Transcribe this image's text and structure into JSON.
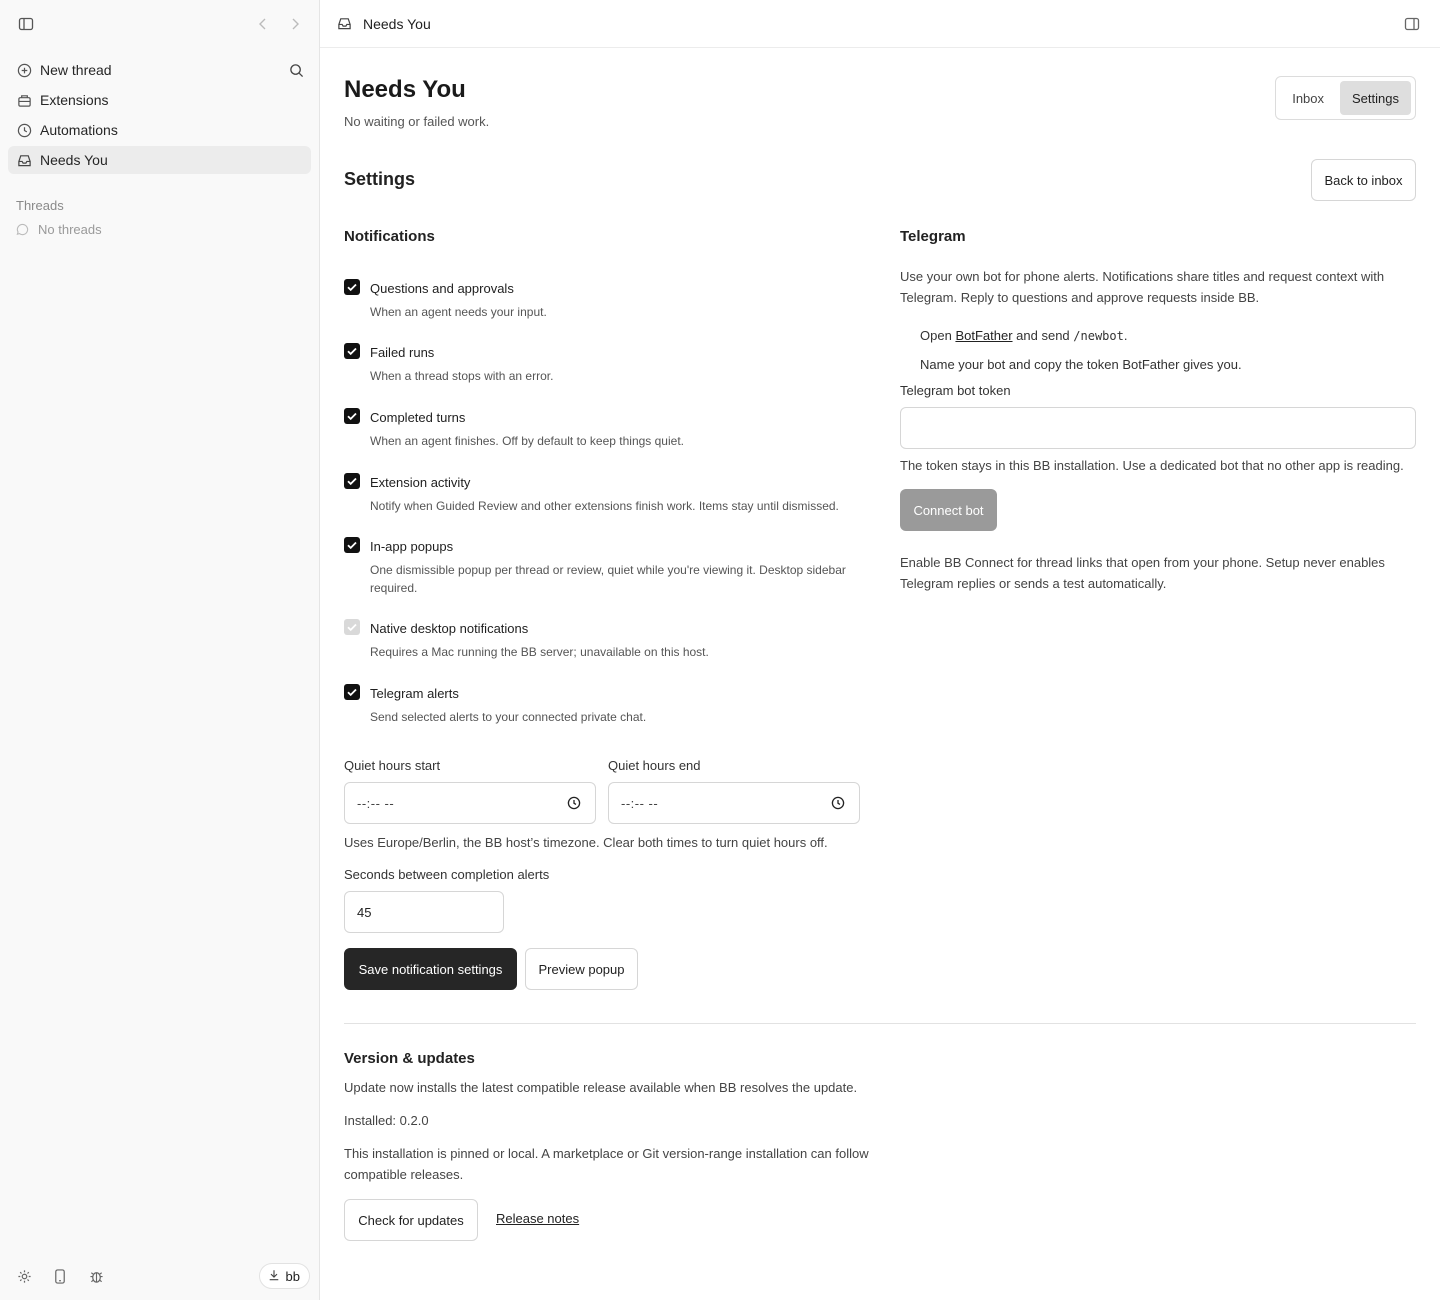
{
  "sidebar": {
    "items": [
      {
        "label": "New thread",
        "icon": "plus-circle-icon"
      },
      {
        "label": "Extensions",
        "icon": "package-icon"
      },
      {
        "label": "Automations",
        "icon": "clock-icon"
      },
      {
        "label": "Needs You",
        "icon": "inbox-icon",
        "active": true
      }
    ],
    "threads_header": "Threads",
    "threads_empty": "No threads",
    "user_label": "bb"
  },
  "topbar": {
    "title": "Needs You"
  },
  "page": {
    "title": "Needs You",
    "subtitle": "No waiting or failed work.",
    "tabs": [
      "Inbox",
      "Settings"
    ],
    "active_tab": "Settings",
    "settings_heading": "Settings",
    "back_label": "Back to inbox"
  },
  "notifications": {
    "heading": "Notifications",
    "options": [
      {
        "label": "Questions and approvals",
        "desc": "When an agent needs your input.",
        "checked": true,
        "disabled": false
      },
      {
        "label": "Failed runs",
        "desc": "When a thread stops with an error.",
        "checked": true,
        "disabled": false
      },
      {
        "label": "Completed turns",
        "desc": "When an agent finishes. Off by default to keep things quiet.",
        "checked": true,
        "disabled": false
      },
      {
        "label": "Extension activity",
        "desc": "Notify when Guided Review and other extensions finish work. Items stay until dismissed.",
        "checked": true,
        "disabled": false
      },
      {
        "label": "In-app popups",
        "desc": "One dismissible popup per thread or review, quiet while you're viewing it. Desktop sidebar required.",
        "checked": true,
        "disabled": false
      },
      {
        "label": "Native desktop notifications",
        "desc": "Requires a Mac running the BB server; unavailable on this host.",
        "checked": true,
        "disabled": true
      },
      {
        "label": "Telegram alerts",
        "desc": "Send selected alerts to your connected private chat.",
        "checked": true,
        "disabled": false
      }
    ],
    "quiet_start_label": "Quiet hours start",
    "quiet_end_label": "Quiet hours end",
    "time_placeholder": "--:-- --",
    "quiet_help": "Uses Europe/Berlin, the BB host’s timezone. Clear both times to turn quiet hours off.",
    "seconds_label": "Seconds between completion alerts",
    "seconds_value": "45",
    "save_label": "Save notification settings",
    "preview_label": "Preview popup"
  },
  "telegram": {
    "heading": "Telegram",
    "intro": "Use your own bot for phone alerts. Notifications share titles and request context with Telegram. Reply to questions and approve requests inside BB.",
    "step1_pre": "Open",
    "step1_link": "BotFather",
    "step1_mid": "and send",
    "step1_code": "/newbot",
    "step1_post": ".",
    "step2": "Name your bot and copy the token BotFather gives you.",
    "token_label": "Telegram bot token",
    "token_value": "",
    "token_help": "The token stays in this BB installation. Use a dedicated bot that no other app is reading.",
    "connect_label": "Connect bot",
    "connect_note": "Enable BB Connect for thread links that open from your phone. Setup never enables Telegram replies or sends a test automatically."
  },
  "version": {
    "heading": "Version & updates",
    "desc": "Update now installs the latest compatible release available when BB resolves the update.",
    "installed": "Installed: 0.2.0",
    "pinned_note": "This installation is pinned or local. A marketplace or Git version-range installation can follow compatible releases.",
    "check_label": "Check for updates",
    "notes_label": "Release notes"
  }
}
